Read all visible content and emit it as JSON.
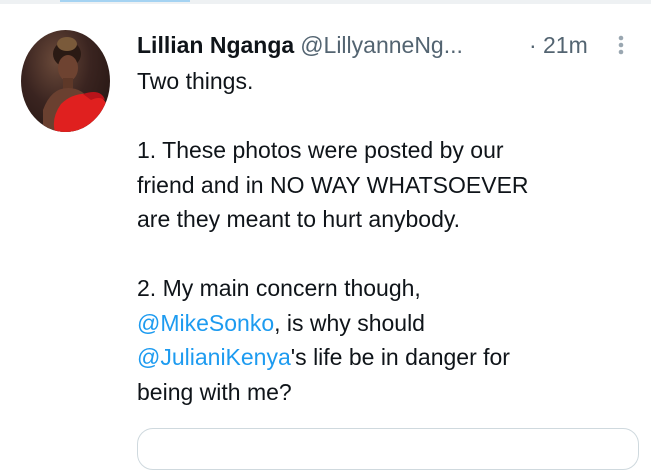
{
  "tweet": {
    "author_name": "Lillian Nganga",
    "author_handle": "@LillyanneNg...",
    "separator": "·",
    "time": "21m",
    "more_icon": "more-vertical-icon",
    "line1": "Two things.",
    "point1_line1": "1. These photos were posted by our",
    "point1_line2": "friend and in NO WAY WHATSOEVER",
    "point1_line3": "are they meant to hurt anybody.",
    "point2_line1": "2. My main concern though,",
    "mention1": "@MikeSonko",
    "point2_after_mention1": ", is why should",
    "mention2": "@JulianiKenya",
    "point2_after_mention2": "'s life be in danger for",
    "point2_line4": "being with me?"
  },
  "colors": {
    "accent": "#1d9bf0",
    "text": "#0f1419",
    "secondary": "#536471",
    "avatar_dress": "#e0201f"
  }
}
